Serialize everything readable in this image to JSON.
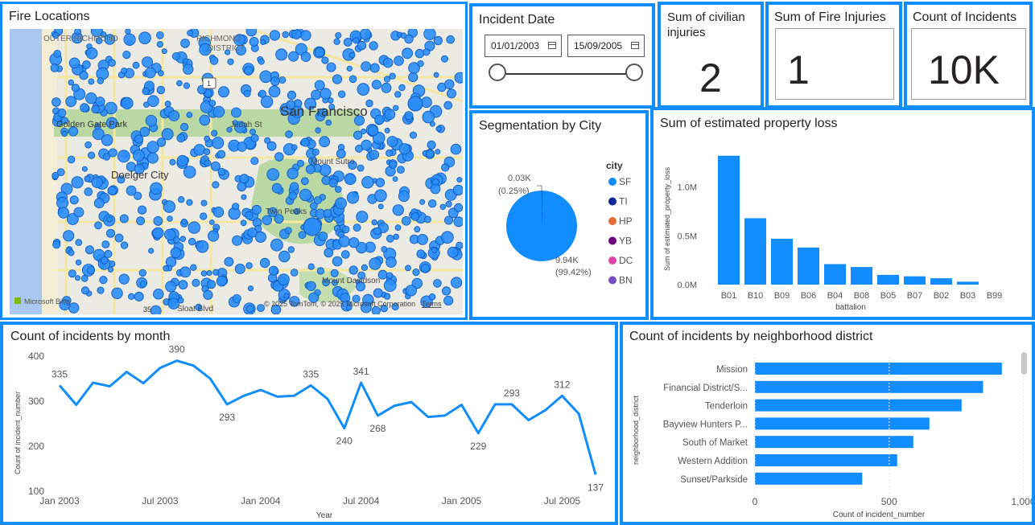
{
  "map": {
    "title": "Fire Locations",
    "labels": [
      {
        "text": "OUTER RICHMOND"
      },
      {
        "text": "RICHMOND"
      },
      {
        "text": "DISTRICT"
      },
      {
        "text": "San Francisco"
      },
      {
        "text": "Golden Gate Park"
      },
      {
        "text": "Judah St"
      },
      {
        "text": "Doelger City"
      },
      {
        "text": "Mount Sutro"
      },
      {
        "text": "Twin Peaks"
      },
      {
        "text": "Mount Davidson"
      },
      {
        "text": "Sloat Blvd"
      }
    ],
    "route_marker": "1",
    "road_marker": "35",
    "bing_logo": "Microsoft Bing",
    "copyright": "© 2025 TomTom, © 2025 Microsoft Corporation",
    "terms": "Terms",
    "colors": {
      "water": "#a9c9f0",
      "land": "#ecebe3",
      "park": "#b9d8a4",
      "dot": "#2b8df7"
    }
  },
  "date_slicer": {
    "title": "Incident Date",
    "start": "01/01/2003",
    "end": "15/09/2005",
    "start_pos": 0,
    "end_pos": 1
  },
  "kpis": {
    "civilian": {
      "label": "Sum of civilian injuries",
      "value": "2"
    },
    "fire_injuries": {
      "label": "Sum of Fire Injuries",
      "value": "1"
    },
    "count": {
      "label": "Count of Incidents",
      "value": "10K"
    }
  },
  "pie": {
    "title": "Segmentation by City",
    "legend_title": "city",
    "legend": [
      {
        "name": "SF",
        "color": "#118dff"
      },
      {
        "name": "TI",
        "color": "#12239e"
      },
      {
        "name": "HP",
        "color": "#e66c37"
      },
      {
        "name": "YB",
        "color": "#6b007b"
      },
      {
        "name": "DC",
        "color": "#e044a7"
      },
      {
        "name": "BN",
        "color": "#744ec2"
      }
    ],
    "label_small": "0.03K",
    "label_small_pct": "(0.25%)",
    "label_big": "9.94K",
    "label_big_pct": "(99.42%)"
  },
  "property_loss": {
    "title": "Sum of estimated property loss",
    "xlabel": "battalion",
    "ylabel": "Sum of estimated_property_loss"
  },
  "monthly": {
    "title": "Count of incidents by month",
    "xlabel": "Year",
    "ylabel": "Count of incident_number"
  },
  "district": {
    "title": "Count of incidents by neighborhood district",
    "xlabel": "Count of incident_number",
    "ylabel": "neighborhood_district"
  },
  "chart_data": [
    {
      "type": "bar",
      "title": "Sum of estimated property loss",
      "xlabel": "battalion",
      "ylabel": "Sum of estimated_property_loss",
      "categories": [
        "B01",
        "B10",
        "B09",
        "B06",
        "B04",
        "B08",
        "B05",
        "B07",
        "B02",
        "B03",
        "B99"
      ],
      "values": [
        1320000,
        680000,
        470000,
        380000,
        210000,
        180000,
        100000,
        85000,
        65000,
        30000,
        0
      ],
      "yticks": [
        0,
        500000,
        1000000
      ],
      "ytick_labels": [
        "0.0M",
        "0.5M",
        "1.0M"
      ],
      "ylim": [
        0,
        1400000
      ],
      "color": "#118dff"
    },
    {
      "type": "line",
      "title": "Count of incidents by month",
      "xlabel": "Year",
      "ylabel": "Count of incident_number",
      "x": [
        "Jan 2003",
        "Feb 2003",
        "Mar 2003",
        "Apr 2003",
        "May 2003",
        "Jun 2003",
        "Jul 2003",
        "Aug 2003",
        "Sep 2003",
        "Oct 2003",
        "Nov 2003",
        "Dec 2003",
        "Jan 2004",
        "Feb 2004",
        "Mar 2004",
        "Apr 2004",
        "May 2004",
        "Jun 2004",
        "Jul 2004",
        "Aug 2004",
        "Sep 2004",
        "Oct 2004",
        "Nov 2004",
        "Dec 2004",
        "Jan 2005",
        "Feb 2005",
        "Mar 2005",
        "Apr 2005",
        "May 2005",
        "Jun 2005",
        "Jul 2005",
        "Aug 2005",
        "Sep 2005"
      ],
      "values": [
        335,
        292,
        341,
        333,
        365,
        340,
        374,
        390,
        379,
        350,
        293,
        312,
        325,
        310,
        312,
        335,
        305,
        240,
        341,
        268,
        290,
        298,
        265,
        268,
        292,
        229,
        293,
        293,
        258,
        280,
        312,
        272,
        137
      ],
      "labeled": [
        {
          "index": 0,
          "text": "335"
        },
        {
          "index": 7,
          "text": "390"
        },
        {
          "index": 10,
          "text": "293"
        },
        {
          "index": 15,
          "text": "335"
        },
        {
          "index": 17,
          "text": "240"
        },
        {
          "index": 18,
          "text": "341"
        },
        {
          "index": 19,
          "text": "268"
        },
        {
          "index": 25,
          "text": "229"
        },
        {
          "index": 27,
          "text": "293"
        },
        {
          "index": 30,
          "text": "312"
        },
        {
          "index": 32,
          "text": "137"
        }
      ],
      "xtick_labels": [
        {
          "index": 0,
          "text": "Jan 2003"
        },
        {
          "index": 6,
          "text": "Jul 2003"
        },
        {
          "index": 12,
          "text": "Jan 2004"
        },
        {
          "index": 18,
          "text": "Jul 2004"
        },
        {
          "index": 24,
          "text": "Jan 2005"
        },
        {
          "index": 30,
          "text": "Jul 2005"
        }
      ],
      "yticks": [
        100,
        200,
        300,
        400
      ],
      "ylim": [
        100,
        400
      ],
      "color": "#118dff"
    },
    {
      "type": "bar",
      "orientation": "horizontal",
      "title": "Count of incidents by neighborhood district",
      "xlabel": "Count of incident_number",
      "ylabel": "neighborhood_district",
      "categories": [
        "Mission",
        "Financial District/S...",
        "Tenderloin",
        "Bayview Hunters P...",
        "South of Market",
        "Western Addition",
        "Sunset/Parkside"
      ],
      "values": [
        920,
        850,
        770,
        650,
        590,
        530,
        400
      ],
      "xticks": [
        0,
        500,
        1000
      ],
      "xtick_labels": [
        "0",
        "500",
        "1,000"
      ],
      "xlim": [
        0,
        1050
      ],
      "color": "#118dff"
    }
  ]
}
